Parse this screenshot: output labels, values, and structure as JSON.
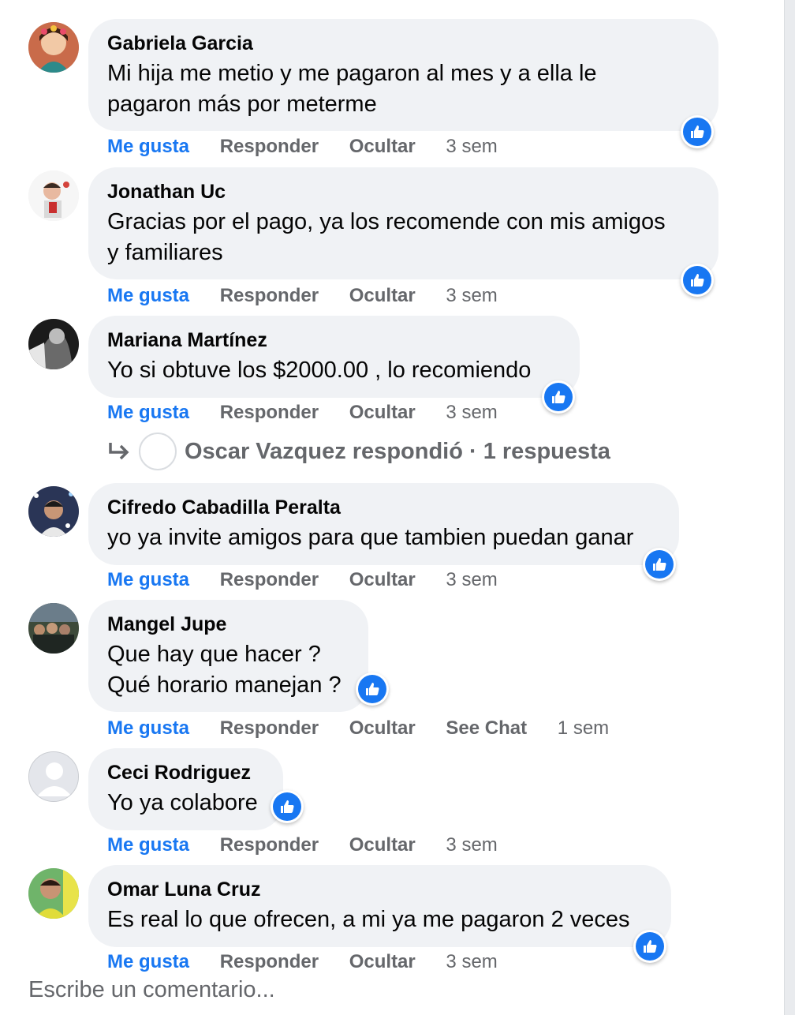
{
  "comments": [
    {
      "author": "Gabriela Garcia",
      "lines": [
        "Mi hija me metio y me pagaron al mes y a ella le",
        "pagaron más por meterme"
      ],
      "actions": [
        "Me gusta",
        "Responder",
        "Ocultar"
      ],
      "time": "3 sem"
    },
    {
      "author": "Jonathan Uc",
      "lines": [
        "Gracias por el pago, ya los recomende con mis amigos",
        "y familiares"
      ],
      "actions": [
        "Me gusta",
        "Responder",
        "Ocultar"
      ],
      "time": "3 sem"
    },
    {
      "author": "Mariana Martínez",
      "lines": [
        "Yo si obtuve los $2000.00 , lo recomiendo"
      ],
      "actions": [
        "Me gusta",
        "Responder",
        "Ocultar"
      ],
      "time": "3 sem"
    },
    {
      "author": "Cifredo Cabadilla Peralta",
      "lines": [
        "yo ya invite amigos para que tambien puedan ganar"
      ],
      "actions": [
        "Me gusta",
        "Responder",
        "Ocultar"
      ],
      "time": "3 sem"
    },
    {
      "author": "Mangel Jupe",
      "lines": [
        "Que hay que hacer ?",
        "Qué horario manejan ?"
      ],
      "actions": [
        "Me gusta",
        "Responder",
        "Ocultar",
        "See Chat"
      ],
      "time": "1 sem"
    },
    {
      "author": "Ceci Rodriguez",
      "lines": [
        "Yo ya colabore"
      ],
      "actions": [
        "Me gusta",
        "Responder",
        "Ocultar"
      ],
      "time": "3 sem"
    },
    {
      "author": "Omar Luna Cruz",
      "lines": [
        "Es real lo que ofrecen, a mi ya me pagaron 2 veces"
      ],
      "actions": [
        "Me gusta",
        "Responder",
        "Ocultar"
      ],
      "time": "3 sem"
    }
  ],
  "reply_summary": {
    "text": "Oscar Vazquez respondió · 1 respuesta",
    "icon": "reply-arrow-icon"
  },
  "composer": {
    "placeholder": "Escribe un comentario..."
  },
  "colors": {
    "accent": "#1877f2",
    "bubble": "#f0f2f5",
    "muted": "#65676b"
  }
}
